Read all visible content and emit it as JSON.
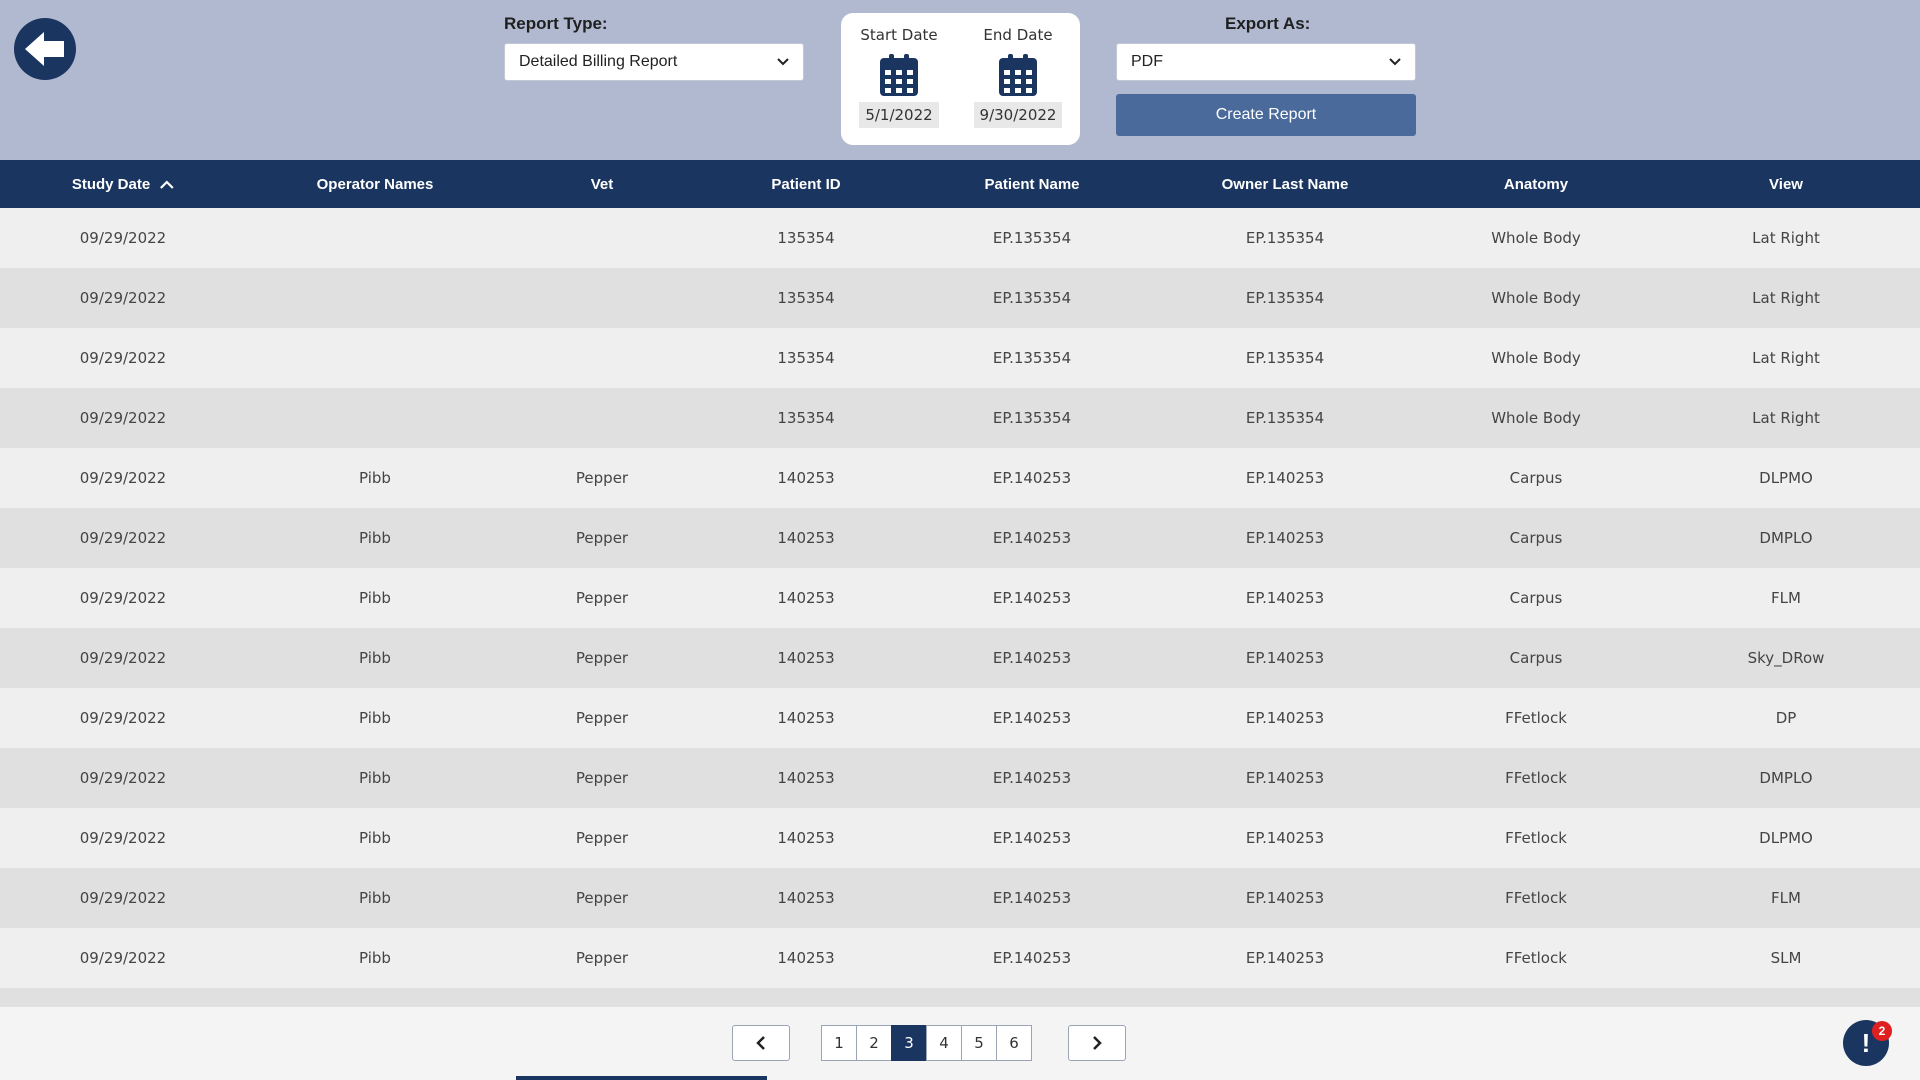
{
  "header": {
    "back_icon": "arrow-left-icon",
    "report_type": {
      "label": "Report Type:",
      "value": "Detailed Billing Report"
    },
    "dates": {
      "start_label": "Start Date",
      "start_value": "5/1/2022",
      "end_label": "End Date",
      "end_value": "9/30/2022",
      "icon": "calendar-icon"
    },
    "export": {
      "label": "Export As:",
      "value": "PDF"
    },
    "create_label": "Create Report"
  },
  "table": {
    "columns": [
      {
        "label": "Study Date",
        "sort": "ascending"
      },
      {
        "label": "Operator Names"
      },
      {
        "label": "Vet"
      },
      {
        "label": "Patient ID"
      },
      {
        "label": "Patient Name"
      },
      {
        "label": "Owner Last Name"
      },
      {
        "label": "Anatomy"
      },
      {
        "label": "View"
      }
    ],
    "rows": [
      [
        "09/29/2022",
        "",
        "",
        "135354",
        "EP.135354",
        "EP.135354",
        "Whole Body",
        "Lat Right"
      ],
      [
        "09/29/2022",
        "",
        "",
        "135354",
        "EP.135354",
        "EP.135354",
        "Whole Body",
        "Lat Right"
      ],
      [
        "09/29/2022",
        "",
        "",
        "135354",
        "EP.135354",
        "EP.135354",
        "Whole Body",
        "Lat Right"
      ],
      [
        "09/29/2022",
        "",
        "",
        "135354",
        "EP.135354",
        "EP.135354",
        "Whole Body",
        "Lat Right"
      ],
      [
        "09/29/2022",
        "Pibb",
        "Pepper",
        "140253",
        "EP.140253",
        "EP.140253",
        "Carpus",
        "DLPMO"
      ],
      [
        "09/29/2022",
        "Pibb",
        "Pepper",
        "140253",
        "EP.140253",
        "EP.140253",
        "Carpus",
        "DMPLO"
      ],
      [
        "09/29/2022",
        "Pibb",
        "Pepper",
        "140253",
        "EP.140253",
        "EP.140253",
        "Carpus",
        "FLM"
      ],
      [
        "09/29/2022",
        "Pibb",
        "Pepper",
        "140253",
        "EP.140253",
        "EP.140253",
        "Carpus",
        "Sky_DRow"
      ],
      [
        "09/29/2022",
        "Pibb",
        "Pepper",
        "140253",
        "EP.140253",
        "EP.140253",
        "FFetlock",
        "DP"
      ],
      [
        "09/29/2022",
        "Pibb",
        "Pepper",
        "140253",
        "EP.140253",
        "EP.140253",
        "FFetlock",
        "DMPLO"
      ],
      [
        "09/29/2022",
        "Pibb",
        "Pepper",
        "140253",
        "EP.140253",
        "EP.140253",
        "FFetlock",
        "DLPMO"
      ],
      [
        "09/29/2022",
        "Pibb",
        "Pepper",
        "140253",
        "EP.140253",
        "EP.140253",
        "FFetlock",
        "FLM"
      ],
      [
        "09/29/2022",
        "Pibb",
        "Pepper",
        "140253",
        "EP.140253",
        "EP.140253",
        "FFetlock",
        "SLM"
      ]
    ]
  },
  "pagination": {
    "pages": [
      "1",
      "2",
      "3",
      "4",
      "5",
      "6"
    ],
    "current": "3",
    "prev_icon": "chevron-left-icon",
    "next_icon": "chevron-right-icon"
  },
  "alert": {
    "icon": "exclamation-icon",
    "count": "2"
  },
  "colors": {
    "header_bg": "#b0b9cf",
    "navy": "#1a3560",
    "button": "#4a6a9c",
    "badge": "#e02020"
  }
}
